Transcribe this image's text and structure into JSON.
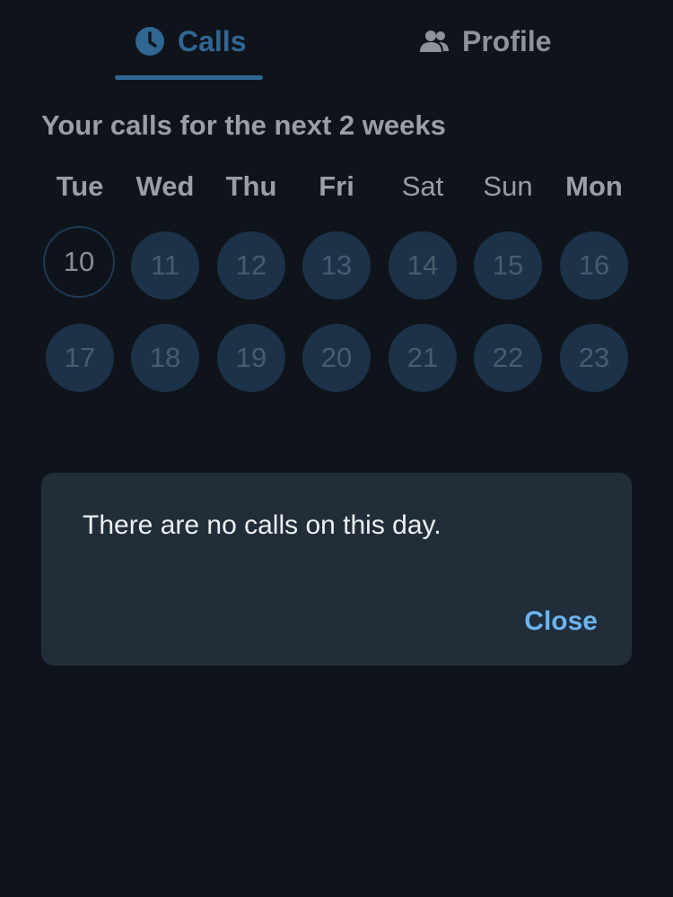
{
  "tabs": {
    "calls": {
      "label": "Calls",
      "icon": "clock-icon",
      "active": true
    },
    "profile": {
      "label": "Profile",
      "icon": "people-icon",
      "active": false
    }
  },
  "heading": "Your calls for the next 2 weeks",
  "calendar": {
    "weekdays": [
      "Tue",
      "Wed",
      "Thu",
      "Fri",
      "Sat",
      "Sun",
      "Mon"
    ],
    "week1": [
      "10",
      "11",
      "12",
      "13",
      "14",
      "15",
      "16"
    ],
    "week2": [
      "17",
      "18",
      "19",
      "20",
      "21",
      "22",
      "23"
    ],
    "selected_day": "10"
  },
  "dialog": {
    "message": "There are no calls on this day.",
    "close_label": "Close"
  },
  "colors": {
    "background": "#0f141b",
    "accent": "#2f6692",
    "day_circle": "#1b3248",
    "dialog_bg": "#212e3a",
    "link": "#6bb4f0"
  }
}
